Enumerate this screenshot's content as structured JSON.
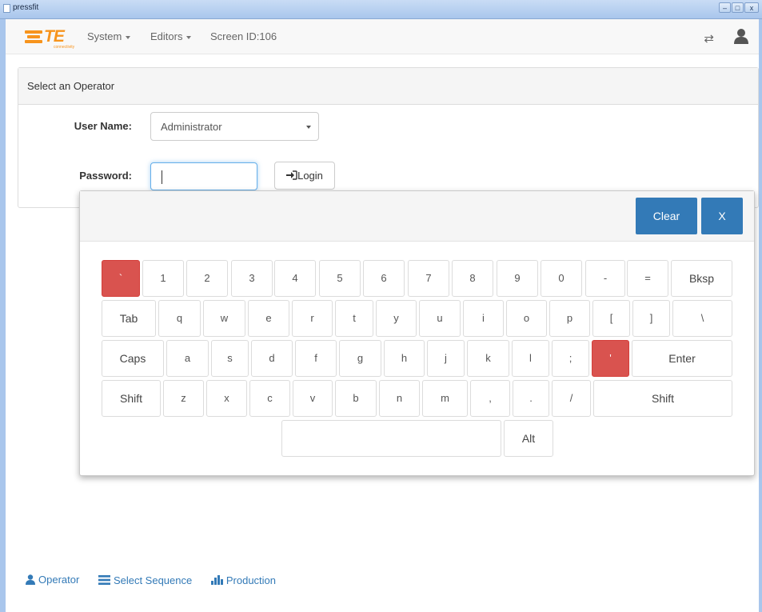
{
  "window": {
    "title": "pressfit",
    "min": "–",
    "max": "□",
    "close": "x"
  },
  "navbar": {
    "logo_text": "TE",
    "logo_sub": "connectivity",
    "menu_system": "System",
    "menu_editors": "Editors",
    "screen_id": "Screen ID:106",
    "swap_icon": "⇄"
  },
  "operator_panel": {
    "heading": "Select an Operator",
    "user_label": "User Name:",
    "user_value": "Administrator",
    "password_label": "Password:",
    "login_label": "Login"
  },
  "keyboard": {
    "clear_label": "Clear",
    "close_label": "X",
    "row1": [
      "`",
      "1",
      "2",
      "3",
      "4",
      "5",
      "6",
      "7",
      "8",
      "9",
      "0",
      "-",
      "=",
      "Bksp"
    ],
    "row2": [
      "Tab",
      "q",
      "w",
      "e",
      "r",
      "t",
      "y",
      "u",
      "i",
      "o",
      "p",
      "[",
      "]",
      "\\"
    ],
    "row3": [
      "Caps",
      "a",
      "s",
      "d",
      "f",
      "g",
      "h",
      "j",
      "k",
      "l",
      ";",
      "'",
      "Enter"
    ],
    "row4": [
      "Shift",
      "z",
      "x",
      "c",
      "v",
      "b",
      "n",
      "m",
      ",",
      ".",
      "/",
      "Shift"
    ],
    "row5": [
      "",
      "Alt"
    ],
    "highlighted_color": "#d9534f"
  },
  "footer": {
    "operator": "Operator",
    "select_sequence": "Select Sequence",
    "production": "Production"
  },
  "colors": {
    "primary": "#337ab7",
    "accent": "#f7941d",
    "danger": "#d9534f"
  }
}
